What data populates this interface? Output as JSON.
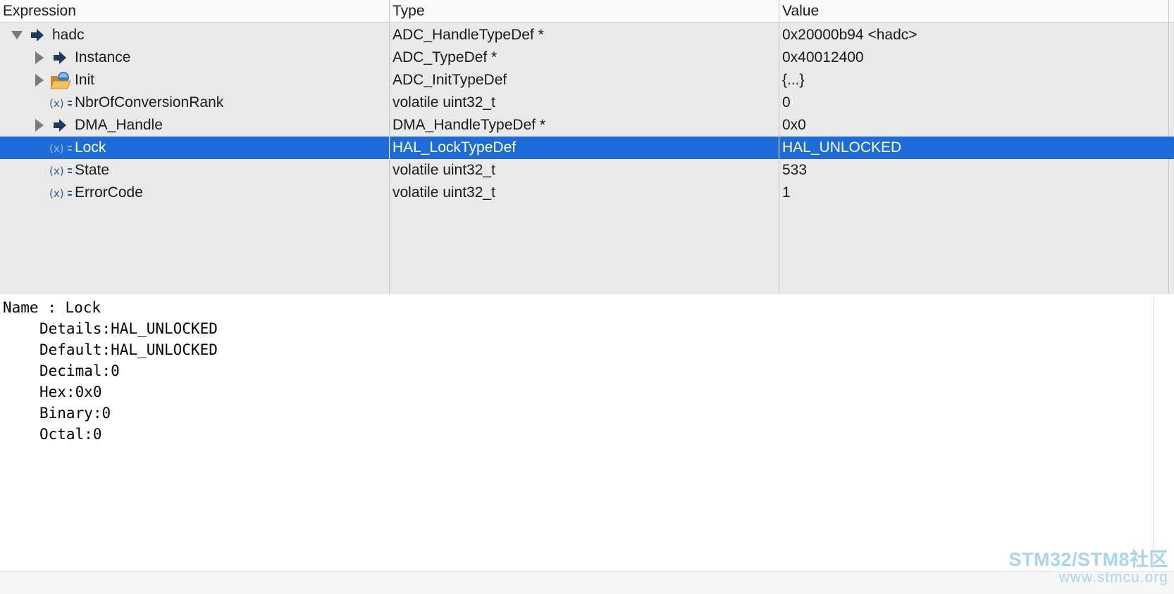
{
  "columns": {
    "expression": "Expression",
    "type": "Type",
    "value": "Value"
  },
  "rows": [
    {
      "name": "hadc",
      "type": "ADC_HandleTypeDef *",
      "value": "0x20000b94 <hadc>",
      "icon": "pointer-icon",
      "twisty": "expanded",
      "selected": false
    },
    {
      "name": "Instance",
      "type": "ADC_TypeDef *",
      "value": "0x40012400",
      "icon": "pointer-icon",
      "twisty": "collapsed",
      "selected": false
    },
    {
      "name": "Init",
      "type": "ADC_InitTypeDef",
      "value": "{...}",
      "icon": "struct-folder-icon",
      "twisty": "collapsed",
      "selected": false
    },
    {
      "name": "NbrOfConversionRank",
      "type": "volatile uint32_t",
      "value": "0",
      "icon": "variable-icon",
      "twisty": "none",
      "selected": false
    },
    {
      "name": "DMA_Handle",
      "type": "DMA_HandleTypeDef *",
      "value": "0x0",
      "icon": "pointer-icon",
      "twisty": "collapsed",
      "selected": false
    },
    {
      "name": "Lock",
      "type": "HAL_LockTypeDef",
      "value": "HAL_UNLOCKED",
      "icon": "variable-icon",
      "twisty": "none",
      "selected": true
    },
    {
      "name": "State",
      "type": "volatile uint32_t",
      "value": "533",
      "icon": "variable-icon",
      "twisty": "none",
      "selected": false
    },
    {
      "name": "ErrorCode",
      "type": "volatile uint32_t",
      "value": "1",
      "icon": "variable-icon",
      "twisty": "none",
      "selected": false
    }
  ],
  "details": {
    "name_line": "Name : Lock",
    "lines": [
      "Details:HAL_UNLOCKED",
      "Default:HAL_UNLOCKED",
      "Decimal:0",
      "Hex:0x0",
      "Binary:0",
      "Octal:0"
    ]
  },
  "watermark": {
    "line1": "STM32/STM8社区",
    "line2": "www.stmcu.org"
  },
  "colors": {
    "selection": "#1d6bd6",
    "tree_background": "#e9e9e9",
    "pointer_icon": "#1f3a5f",
    "watermark": "#a8d4ee"
  }
}
